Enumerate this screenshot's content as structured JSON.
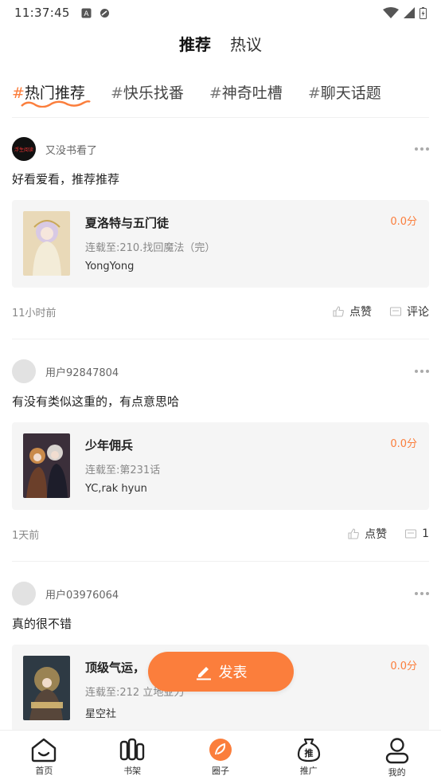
{
  "status_bar": {
    "time": "11:37:45"
  },
  "top_tabs": [
    {
      "label": "推荐",
      "active": true
    },
    {
      "label": "热议",
      "active": false
    }
  ],
  "category_tabs": [
    {
      "hash": "#",
      "label": "热门推荐",
      "active": true
    },
    {
      "hash": "#",
      "label": "快乐找番",
      "active": false
    },
    {
      "hash": "#",
      "label": "神奇吐槽",
      "active": false
    },
    {
      "hash": "#",
      "label": "聊天话题",
      "active": false
    }
  ],
  "posts": [
    {
      "username": "又没书看了",
      "avatar_text": "浮生阅读",
      "text": "好看爱看，推荐推荐",
      "book": {
        "title": "夏洛特与五门徒",
        "chapter": "连载至:210.找回魔法（完）",
        "author": "YongYong",
        "score": "0.0分"
      },
      "time": "11小时前",
      "like_label": "点赞",
      "comment_label": "评论"
    },
    {
      "username": "用户92847804",
      "text": "有没有类似这重的，有点意思哈",
      "book": {
        "title": "少年佣兵",
        "chapter": "连载至:第231话",
        "author": "YC,rak hyun",
        "score": "0.0分"
      },
      "time": "1天前",
      "like_label": "点赞",
      "comment_label": "1"
    },
    {
      "username": "用户03976064",
      "text": "真的很不错",
      "book": {
        "title": "顶级气运，",
        "chapter": "连载至:212 立地亚力",
        "author": "星空社",
        "score": "0.0分"
      }
    }
  ],
  "publish_button": {
    "label": "发表"
  },
  "bottom_nav": [
    {
      "label": "首页",
      "icon": "home-icon",
      "active": false
    },
    {
      "label": "书架",
      "icon": "bookshelf-icon",
      "active": false
    },
    {
      "label": "圈子",
      "icon": "circle-icon",
      "active": true
    },
    {
      "label": "推广",
      "icon": "promote-icon",
      "active": false
    },
    {
      "label": "我的",
      "icon": "profile-icon",
      "active": false
    }
  ],
  "colors": {
    "accent": "#fb7e3c",
    "card_bg": "#f5f5f5",
    "muted_text": "#888888"
  }
}
